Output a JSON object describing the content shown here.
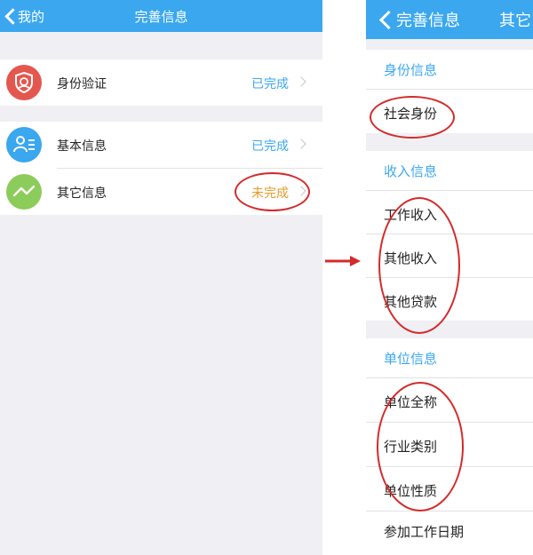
{
  "left_screen": {
    "navbar": {
      "back_label": "我的",
      "title": "完善信息"
    },
    "items": [
      {
        "label": "身份验证",
        "status": "已完成",
        "icon": "shield-face-icon",
        "icon_color": "#e4574e",
        "status_color": "#3aa7ef"
      },
      {
        "label": "基本信息",
        "status": "已完成",
        "icon": "person-list-icon",
        "icon_color": "#3aa7ef",
        "status_color": "#3aa7ef"
      },
      {
        "label": "其它信息",
        "status": "未完成",
        "icon": "wave-line-icon",
        "icon_color": "#8ccc5a",
        "status_color": "#e69a2a"
      }
    ]
  },
  "right_screen": {
    "navbar": {
      "back_label": "完善信息",
      "title": "其它"
    },
    "sections": [
      {
        "header": "身份信息",
        "items": [
          "社会身份"
        ]
      },
      {
        "header": "收入信息",
        "items": [
          "工作收入",
          "其他收入",
          "其他贷款"
        ]
      },
      {
        "header": "单位信息",
        "items": [
          "单位全称",
          "行业类别",
          "单位性质",
          "参加工作日期"
        ]
      }
    ]
  },
  "colors": {
    "accent": "#3aa7ef",
    "annotation": "#d42a2a",
    "background": "#efeff4"
  },
  "annotation": {
    "arrow": "right-arrow-icon"
  }
}
